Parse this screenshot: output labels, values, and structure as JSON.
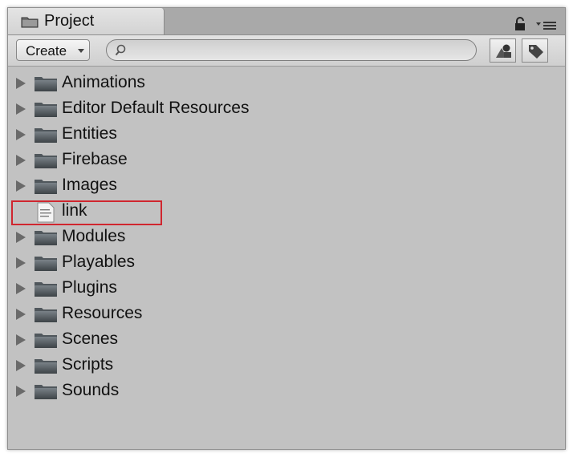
{
  "panel": {
    "tab_title": "Project"
  },
  "toolbar": {
    "create_label": "Create",
    "search_placeholder": ""
  },
  "icons": {
    "tab": "folder-icon",
    "lock": "lock-icon",
    "menu": "panel-menu-icon",
    "search": "search-icon",
    "filter_type": "filter-by-type-icon",
    "filter_label": "filter-by-label-icon"
  },
  "items": [
    {
      "label": "Animations",
      "type": "folder"
    },
    {
      "label": "Editor Default Resources",
      "type": "folder"
    },
    {
      "label": "Entities",
      "type": "folder"
    },
    {
      "label": "Firebase",
      "type": "folder"
    },
    {
      "label": "Images",
      "type": "folder"
    },
    {
      "label": "link",
      "type": "file"
    },
    {
      "label": "Modules",
      "type": "folder"
    },
    {
      "label": "Playables",
      "type": "folder"
    },
    {
      "label": "Plugins",
      "type": "folder"
    },
    {
      "label": "Resources",
      "type": "folder"
    },
    {
      "label": "Scenes",
      "type": "folder"
    },
    {
      "label": "Scripts",
      "type": "folder"
    },
    {
      "label": "Sounds",
      "type": "folder"
    }
  ],
  "highlighted_item": "link",
  "colors": {
    "highlight_border": "#d0262f",
    "panel_bg": "#c2c2c2"
  }
}
